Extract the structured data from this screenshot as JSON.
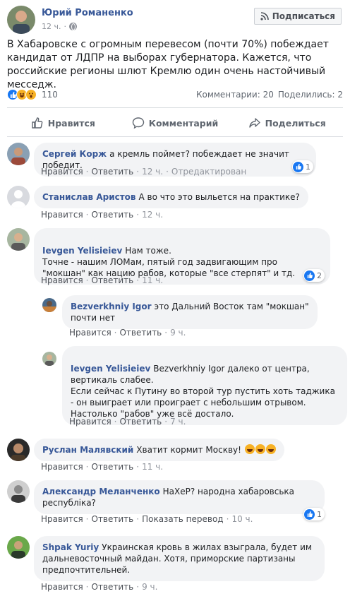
{
  "post": {
    "author": "Юрий Романенко",
    "time": "12 ч.",
    "subscribe_label": "Подписаться",
    "text": "В Хабаровске с огромным перевесом (почти 70%) побеждает кандидат от ЛДПР на выборах губернатора. Кажется, что российские регионы шлют Кремлю один очень настойчивый месседж.",
    "reaction_count": "110",
    "comments_stat": "Комментарии: 20",
    "shares_stat": "Поделились: 2",
    "actions": {
      "like": "Нравится",
      "comment": "Комментарий",
      "share": "Поделиться"
    }
  },
  "colors": {
    "accent": "#385898",
    "like_blue": "#1877f2",
    "bubble": "#f2f3f5"
  },
  "labels": {
    "like": "Нравится",
    "reply": "Ответить",
    "show_translation": "Показать перевод",
    "edited": "Отредактирован"
  },
  "comments": [
    {
      "name": "Сергей Корж",
      "text": "а кремль поймет? побеждает не значит победит.",
      "time": "12 ч.",
      "likes": "1"
    },
    {
      "name": "Станислав Аристов",
      "text": "А во что это выльется на практике?",
      "time": "12 ч."
    },
    {
      "name": "Ievgen Yelisieiev",
      "text": "Нам тоже.\nТочне - нашим ЛОМам, пятый год задвигающим про \"мокшан\" как нацию рабов, которые \"все стерпят\" и тд.",
      "time": "11 ч.",
      "likes": "2"
    },
    {
      "name": "Bezverkhniy Igor",
      "text": "это Дальний Восток там \"мокшан\" почти нет",
      "time": "9 ч."
    },
    {
      "name": "Ievgen Yelisieiev",
      "text": "Bezverkhniy Igor далеко от центра, вертикаль слабее.\nЕсли сейчас к Путину во второй тур пустить хоть таджика - он выиграет или проиграет с небольшим отрывом. Настолько \"рабов\" уже всё достало.",
      "time": "7 ч."
    },
    {
      "name": "Руслан Малявский",
      "text": "Хватит кормит Москву!",
      "time": "11 ч."
    },
    {
      "name": "Александр Меланченко",
      "text": "НаХеР? народна хабаровська республіка?",
      "time": "10 ч.",
      "likes": "1"
    },
    {
      "name": "Shpak Yuriy",
      "text": "Украинская кровь в жилах взыграла, будет им дальневосточный майдан. Хотя, приморские партизаны предпочтительней.",
      "time": "9 ч."
    }
  ]
}
